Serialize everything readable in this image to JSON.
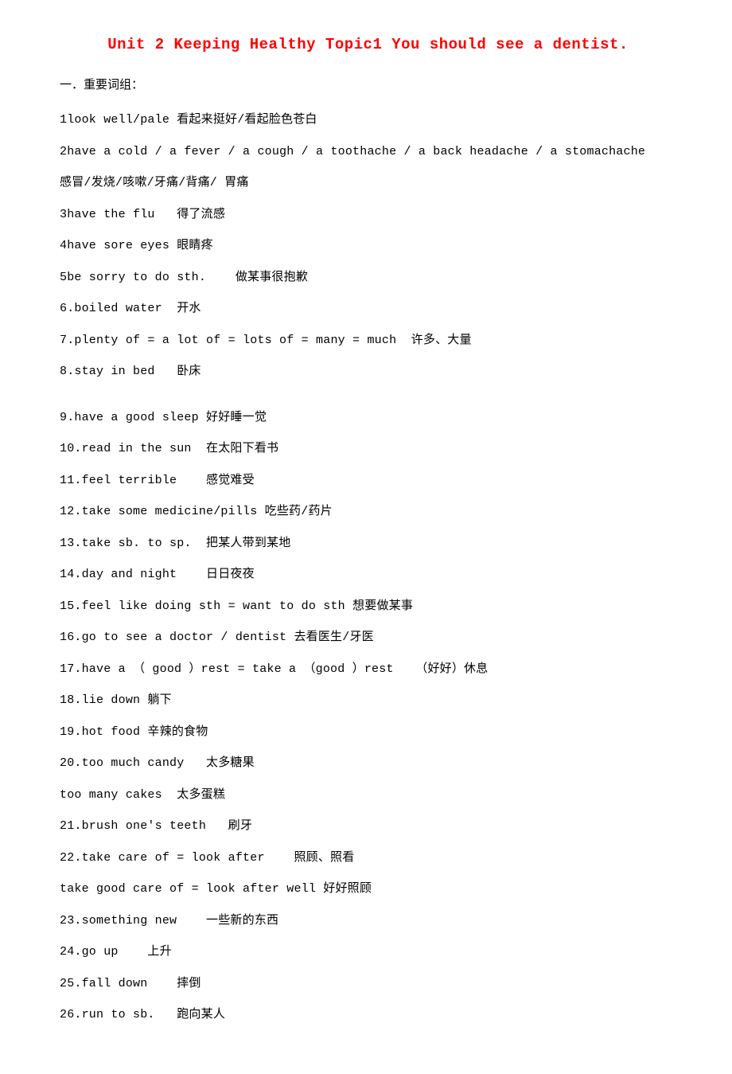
{
  "title": "Unit 2   Keeping Healthy   Topic1 You should see a dentist.",
  "section_heading": "一．重要词组：",
  "lines": [
    "1look well/pale 看起来挺好/看起脸色苍白",
    "2have a cold / a fever / a cough / a toothache / a back headache / a stomachache",
    "感冒/发烧/咳嗽/牙痛/背痛/ 胃痛",
    "3have the flu   得了流感",
    "4have sore eyes 眼睛疼",
    "5be sorry to do sth.    做某事很抱歉",
    "6.boiled water  开水",
    "7.plenty of = a lot of = lots of = many = much  许多、大量",
    "8.stay in bed   卧床",
    "__GAP__",
    "9.have a good sleep 好好睡一觉",
    "10.read in the sun  在太阳下看书",
    "11.feel terrible    感觉难受",
    "12.take some medicine/pills 吃些药/药片",
    "13.take sb. to sp.  把某人带到某地",
    "14.day and night    日日夜夜",
    "15.feel like doing sth = want to do sth 想要做某事",
    "16.go to see a doctor / dentist 去看医生/牙医",
    "17.have a （ good ）rest = take a （good ）rest   （好好）休息",
    "18.lie down 躺下",
    "19.hot food 辛辣的食物",
    "20.too much candy   太多糖果",
    "too many cakes  太多蛋糕",
    "21.brush one's teeth   刷牙",
    "22.take care of = look after    照顾、照看",
    "take good care of = look after well 好好照顾",
    "23.something new    一些新的东西",
    "24.go up    上升",
    "25.fall down    摔倒",
    "26.run to sb.   跑向某人"
  ]
}
